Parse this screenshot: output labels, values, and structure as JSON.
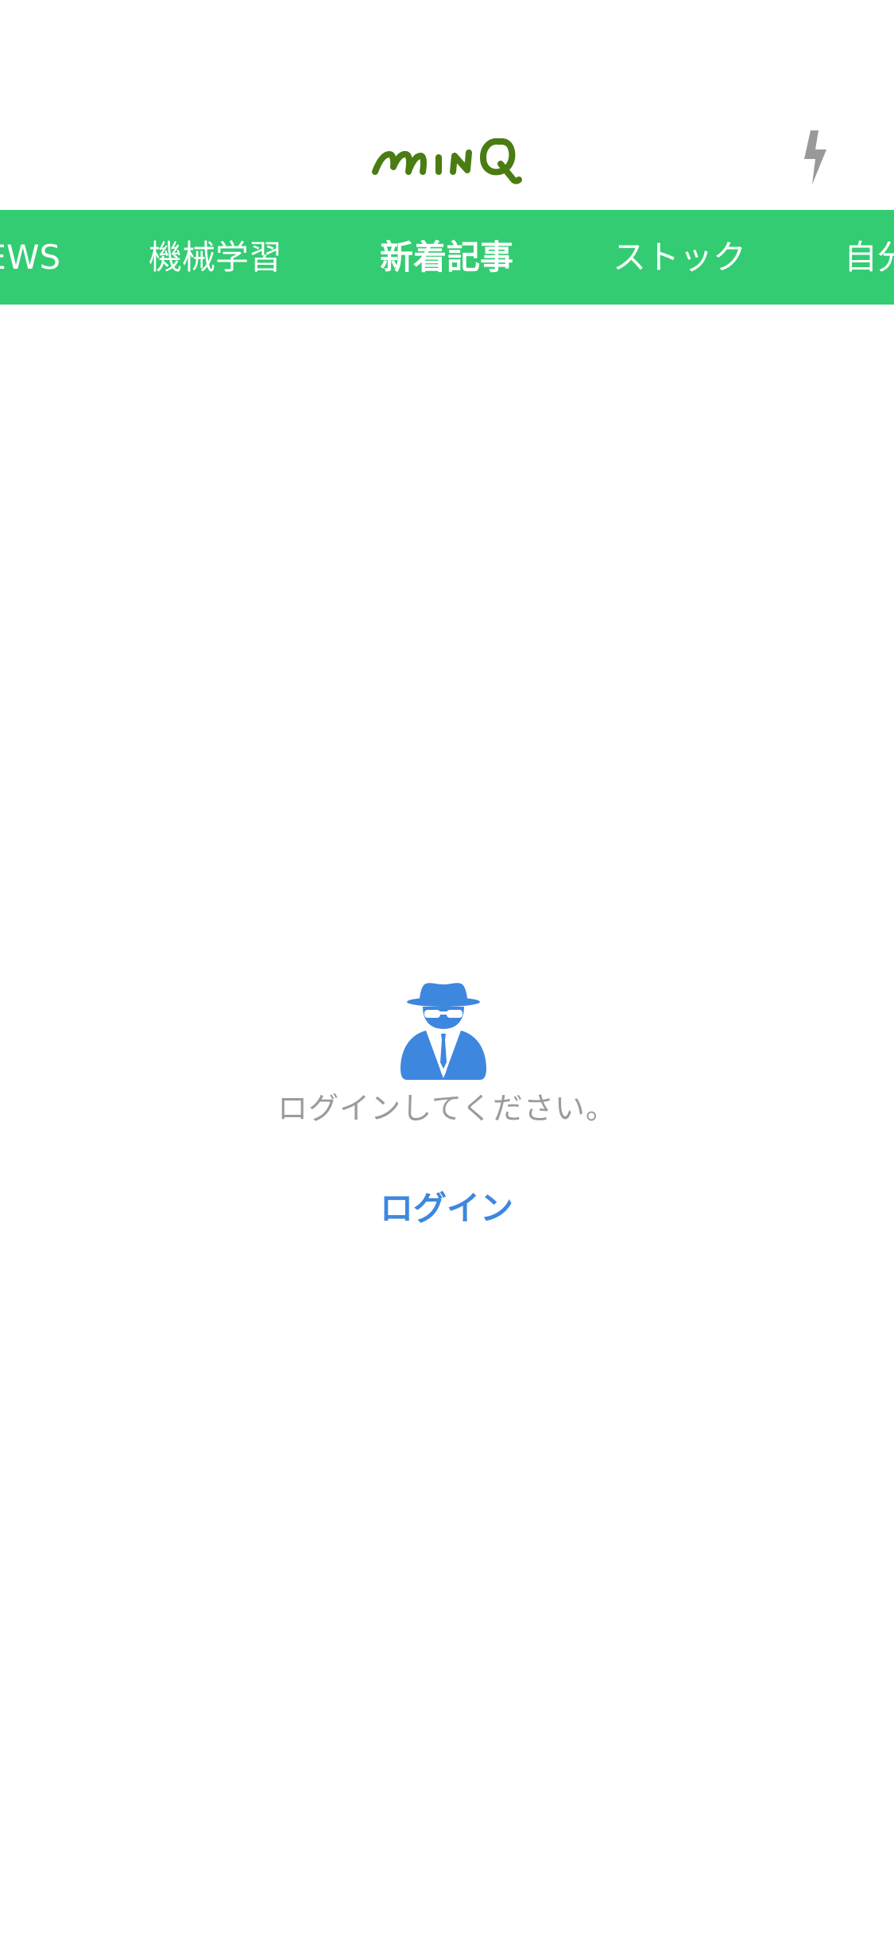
{
  "header": {
    "logo_text": "minq",
    "flash_icon": "lightning-bolt-icon"
  },
  "tabs": [
    {
      "label": "NEWS"
    },
    {
      "label": "機械学習"
    },
    {
      "label": "新着記事",
      "active": true
    },
    {
      "label": "ストック"
    },
    {
      "label": "自分"
    }
  ],
  "main": {
    "icon": "spy-incognito-icon",
    "message": "ログインしてください。",
    "login_button": "ログイン"
  },
  "colors": {
    "tab_bar": "#33cc72",
    "logo": "#4a7c12",
    "accent": "#3e87de",
    "muted_text": "#9b9b9b",
    "flash_icon": "#999999"
  }
}
